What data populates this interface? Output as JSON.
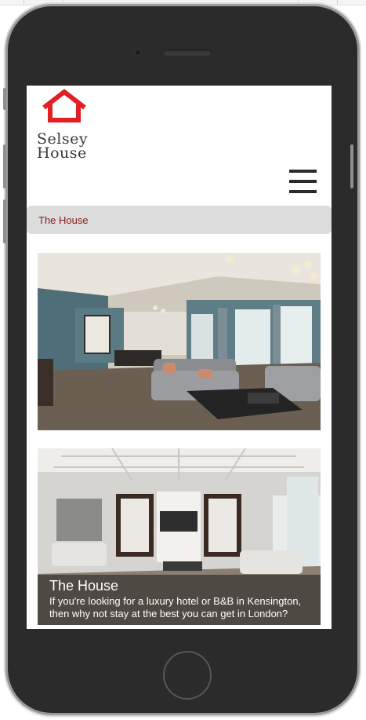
{
  "site": {
    "logo_line1": "Selsey",
    "logo_line2": "House",
    "logo_color": "#e31e24"
  },
  "nav": {
    "menu_icon": "hamburger-menu-icon"
  },
  "breadcrumb": {
    "label": "The House",
    "color": "#8b1a1a"
  },
  "cards": [
    {
      "image": "living-room-photo",
      "title": "",
      "text": ""
    },
    {
      "image": "white-lounge-photo",
      "title": "The House",
      "text": "If you're looking for a luxury hotel or B&B in Kensington, then why not stay at the best you can get in London?"
    }
  ]
}
